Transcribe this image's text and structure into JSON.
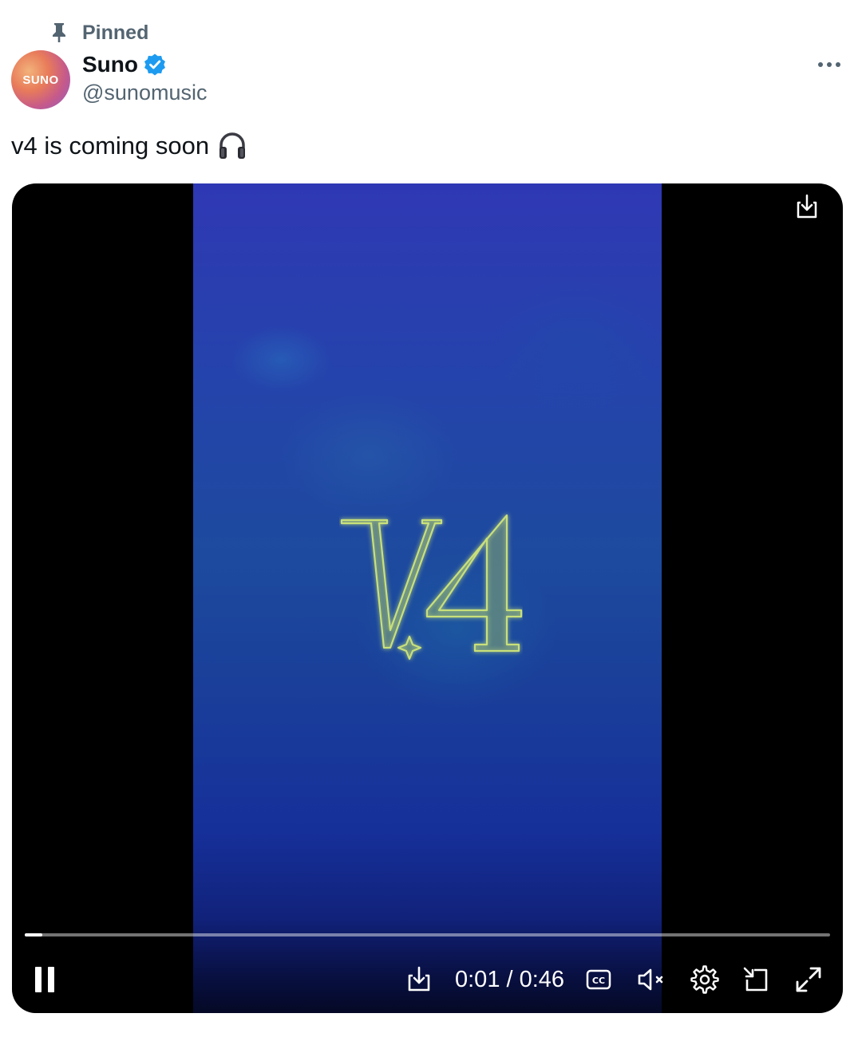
{
  "pinned": {
    "label": "Pinned"
  },
  "author": {
    "avatar_text": "SUNO",
    "display_name": "Suno",
    "handle": "@sunomusic",
    "verified": true
  },
  "tweet": {
    "text": "v4 is coming soon",
    "emoji": "headphones-icon"
  },
  "video": {
    "current_time": "0:01",
    "duration": "0:46",
    "time_label": "0:01 / 0:46",
    "progress_fraction": 0.022,
    "muted": true,
    "playing": true,
    "logo_text": "V4"
  },
  "colors": {
    "accent": "#1d9bf0",
    "secondary_text": "#536471",
    "logo_glow": "#c8e07a"
  }
}
